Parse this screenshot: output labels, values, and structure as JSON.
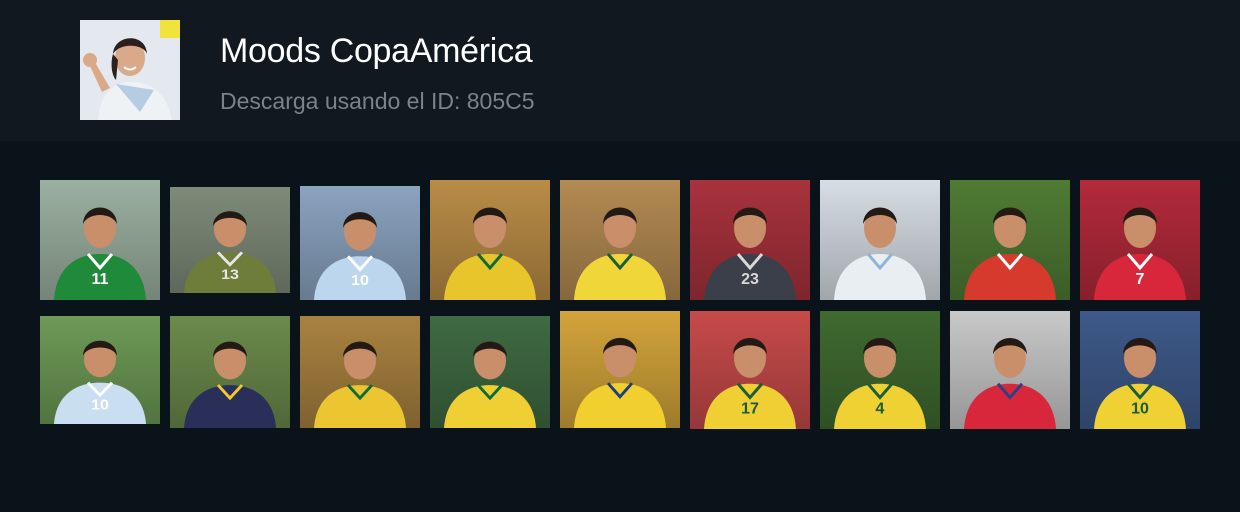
{
  "pack": {
    "title": "Moods CopaAmérica",
    "subtitle": "Descarga usando el ID: 805C5"
  },
  "colors": {
    "header_bg": "#111820",
    "page_bg": "#0b131a",
    "title": "#ffffff",
    "subtitle": "#7a828a"
  },
  "stickers": [
    {
      "team": "mexico",
      "number": "11",
      "kit": "#1f8a3a",
      "trim": "#ffffff",
      "bg": "#9bb0a0"
    },
    {
      "team": "mexico",
      "number": "13",
      "kit": "#6f7d3a",
      "trim": "#e6e6e6",
      "bg": "#7e8b79"
    },
    {
      "team": "argentina",
      "number": "10",
      "kit": "#bcd6ee",
      "trim": "#ffffff",
      "bg": "#8aa3bf"
    },
    {
      "team": "brazil",
      "number": "",
      "kit": "#e8c52a",
      "trim": "#0c6b3a",
      "bg": "#b98c46"
    },
    {
      "team": "brazil",
      "number": "",
      "kit": "#f1d63a",
      "trim": "#1a5d38",
      "bg": "#b38a52"
    },
    {
      "team": "uruguay",
      "number": "23",
      "kit": "#3a3f49",
      "trim": "#d8d8d8",
      "bg": "#a8323d"
    },
    {
      "team": "uruguay",
      "number": "",
      "kit": "#e9eef2",
      "trim": "#8fb3d6",
      "bg": "#d6dde3"
    },
    {
      "team": "chile",
      "number": "",
      "kit": "#d63a2c",
      "trim": "#ffffff",
      "bg": "#4f7b34"
    },
    {
      "team": "chile",
      "number": "7",
      "kit": "#d8263a",
      "trim": "#ffffff",
      "bg": "#b32a3a"
    },
    {
      "team": "argentina",
      "number": "10",
      "kit": "#c9def0",
      "trim": "#ffffff",
      "bg": "#6d9a56"
    },
    {
      "team": "colombia",
      "number": "",
      "kit": "#2a2f5a",
      "trim": "#f3c92c",
      "bg": "#6b8a4b"
    },
    {
      "team": "brazil",
      "number": "",
      "kit": "#ecc631",
      "trim": "#0c6b3a",
      "bg": "#a98240"
    },
    {
      "team": "brazil",
      "number": "",
      "kit": "#f0cf35",
      "trim": "#0c6b3a",
      "bg": "#3f6a42"
    },
    {
      "team": "colombia",
      "number": "",
      "kit": "#f1cf2f",
      "trim": "#1d3f7a",
      "bg": "#d2a43a"
    },
    {
      "team": "brazil",
      "number": "17",
      "kit": "#efcf33",
      "trim": "#1a5d38",
      "bg": "#c74a4a"
    },
    {
      "team": "brazil",
      "number": "4",
      "kit": "#f0d134",
      "trim": "#1a5d38",
      "bg": "#3f6a30"
    },
    {
      "team": "chile",
      "number": "",
      "kit": "#d8263a",
      "trim": "#2d3f8a",
      "bg": "#c8c8c8"
    },
    {
      "team": "brazil",
      "number": "10",
      "kit": "#f0d134",
      "trim": "#1a5d38",
      "bg": "#3e5a8a"
    }
  ]
}
